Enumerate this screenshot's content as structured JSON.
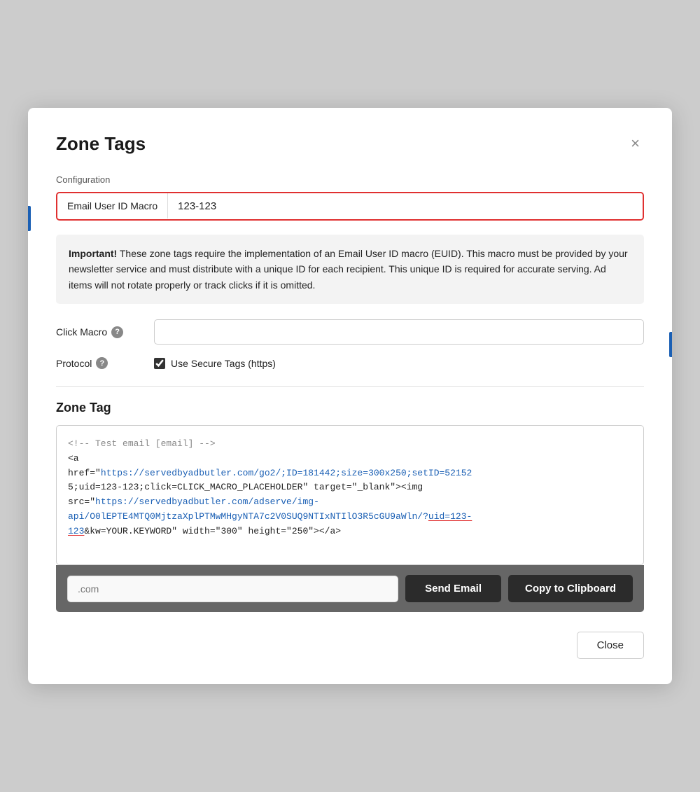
{
  "modal": {
    "title": "Zone Tags",
    "close_icon": "×"
  },
  "configuration": {
    "section_label": "Configuration",
    "email_macro": {
      "label": "Email User ID Macro",
      "value": "123-123",
      "placeholder": ""
    },
    "info_box": {
      "bold_text": "Important!",
      "text": " These zone tags require the implementation of an Email User ID macro (EUID). This macro must be provided by your newsletter service and must distribute with a unique ID for each recipient. This unique ID is required for accurate serving. Ad items will not rotate properly or track clicks if it is omitted."
    },
    "click_macro": {
      "label": "Click Macro",
      "help_icon": "?",
      "value": "",
      "placeholder": ""
    },
    "protocol": {
      "label": "Protocol",
      "help_icon": "?",
      "checkbox_checked": true,
      "checkbox_label": "Use Secure Tags (https)"
    }
  },
  "zone_tag": {
    "label": "Zone Tag",
    "code": {
      "line1": "<!-- Test email [email] -->",
      "line2": "<a",
      "line3_before": "href=\"",
      "line3_url": "https://servedbyadbutler.com/go2/;ID=181442;size=300x250;setID=52152",
      "line3_after": "",
      "line4": "5;uid=123-123;click=CLICK_MACRO_PLACEHOLDER\" target=\"_blank\"><img",
      "line5_before": "src=\"",
      "line5_url": "https://servedbyadbutler.com/adserve/img-",
      "line6_before": "api/O0lEPTE4MTQ0MjtzaXplPTMwMHgyNTA7c2V0SUQ9NTIxNTIlO3R5cGU9aWln/?uid=123-",
      "line7_before": "123",
      "line7_after": "&kw=YOUR.KEYWORD\" width=\"300\" height=\"250\"></a>"
    }
  },
  "bottom_bar": {
    "email_placeholder": ".com",
    "send_email_label": "Send Email",
    "copy_label": "Copy to Clipboard"
  },
  "footer": {
    "close_label": "Close"
  }
}
